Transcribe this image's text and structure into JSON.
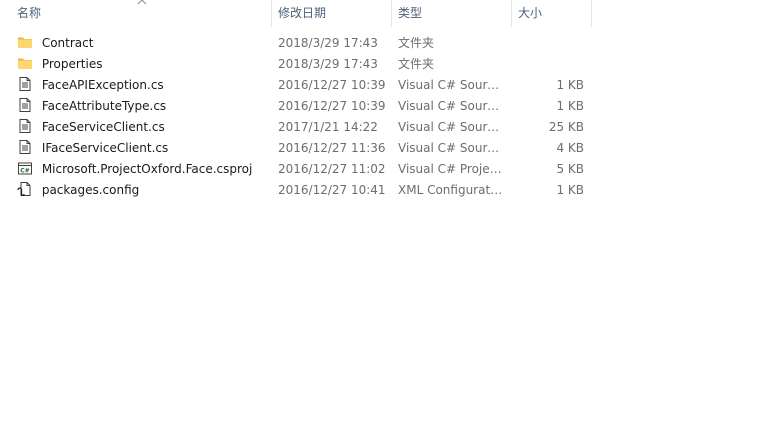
{
  "columns": {
    "name": "名称",
    "date": "修改日期",
    "type": "类型",
    "size": "大小"
  },
  "files": [
    {
      "name": "Contract",
      "date": "2018/3/29 17:43",
      "type": "文件夹",
      "size": "",
      "icon": "folder-icon"
    },
    {
      "name": "Properties",
      "date": "2018/3/29 17:43",
      "type": "文件夹",
      "size": "",
      "icon": "folder-icon"
    },
    {
      "name": "FaceAPIException.cs",
      "date": "2016/12/27 10:39",
      "type": "Visual C# Sourc...",
      "size": "1 KB",
      "icon": "cs-file-icon"
    },
    {
      "name": "FaceAttributeType.cs",
      "date": "2016/12/27 10:39",
      "type": "Visual C# Sourc...",
      "size": "1 KB",
      "icon": "cs-file-icon"
    },
    {
      "name": "FaceServiceClient.cs",
      "date": "2017/1/21 14:22",
      "type": "Visual C# Sourc...",
      "size": "25 KB",
      "icon": "cs-file-icon"
    },
    {
      "name": "IFaceServiceClient.cs",
      "date": "2016/12/27 11:36",
      "type": "Visual C# Sourc...",
      "size": "4 KB",
      "icon": "cs-file-icon"
    },
    {
      "name": "Microsoft.ProjectOxford.Face.csproj",
      "date": "2016/12/27 11:02",
      "type": "Visual C# Projec...",
      "size": "5 KB",
      "icon": "csproj-file-icon"
    },
    {
      "name": "packages.config",
      "date": "2016/12/27 10:41",
      "type": "XML Configurati...",
      "size": "1 KB",
      "icon": "config-file-icon"
    }
  ]
}
